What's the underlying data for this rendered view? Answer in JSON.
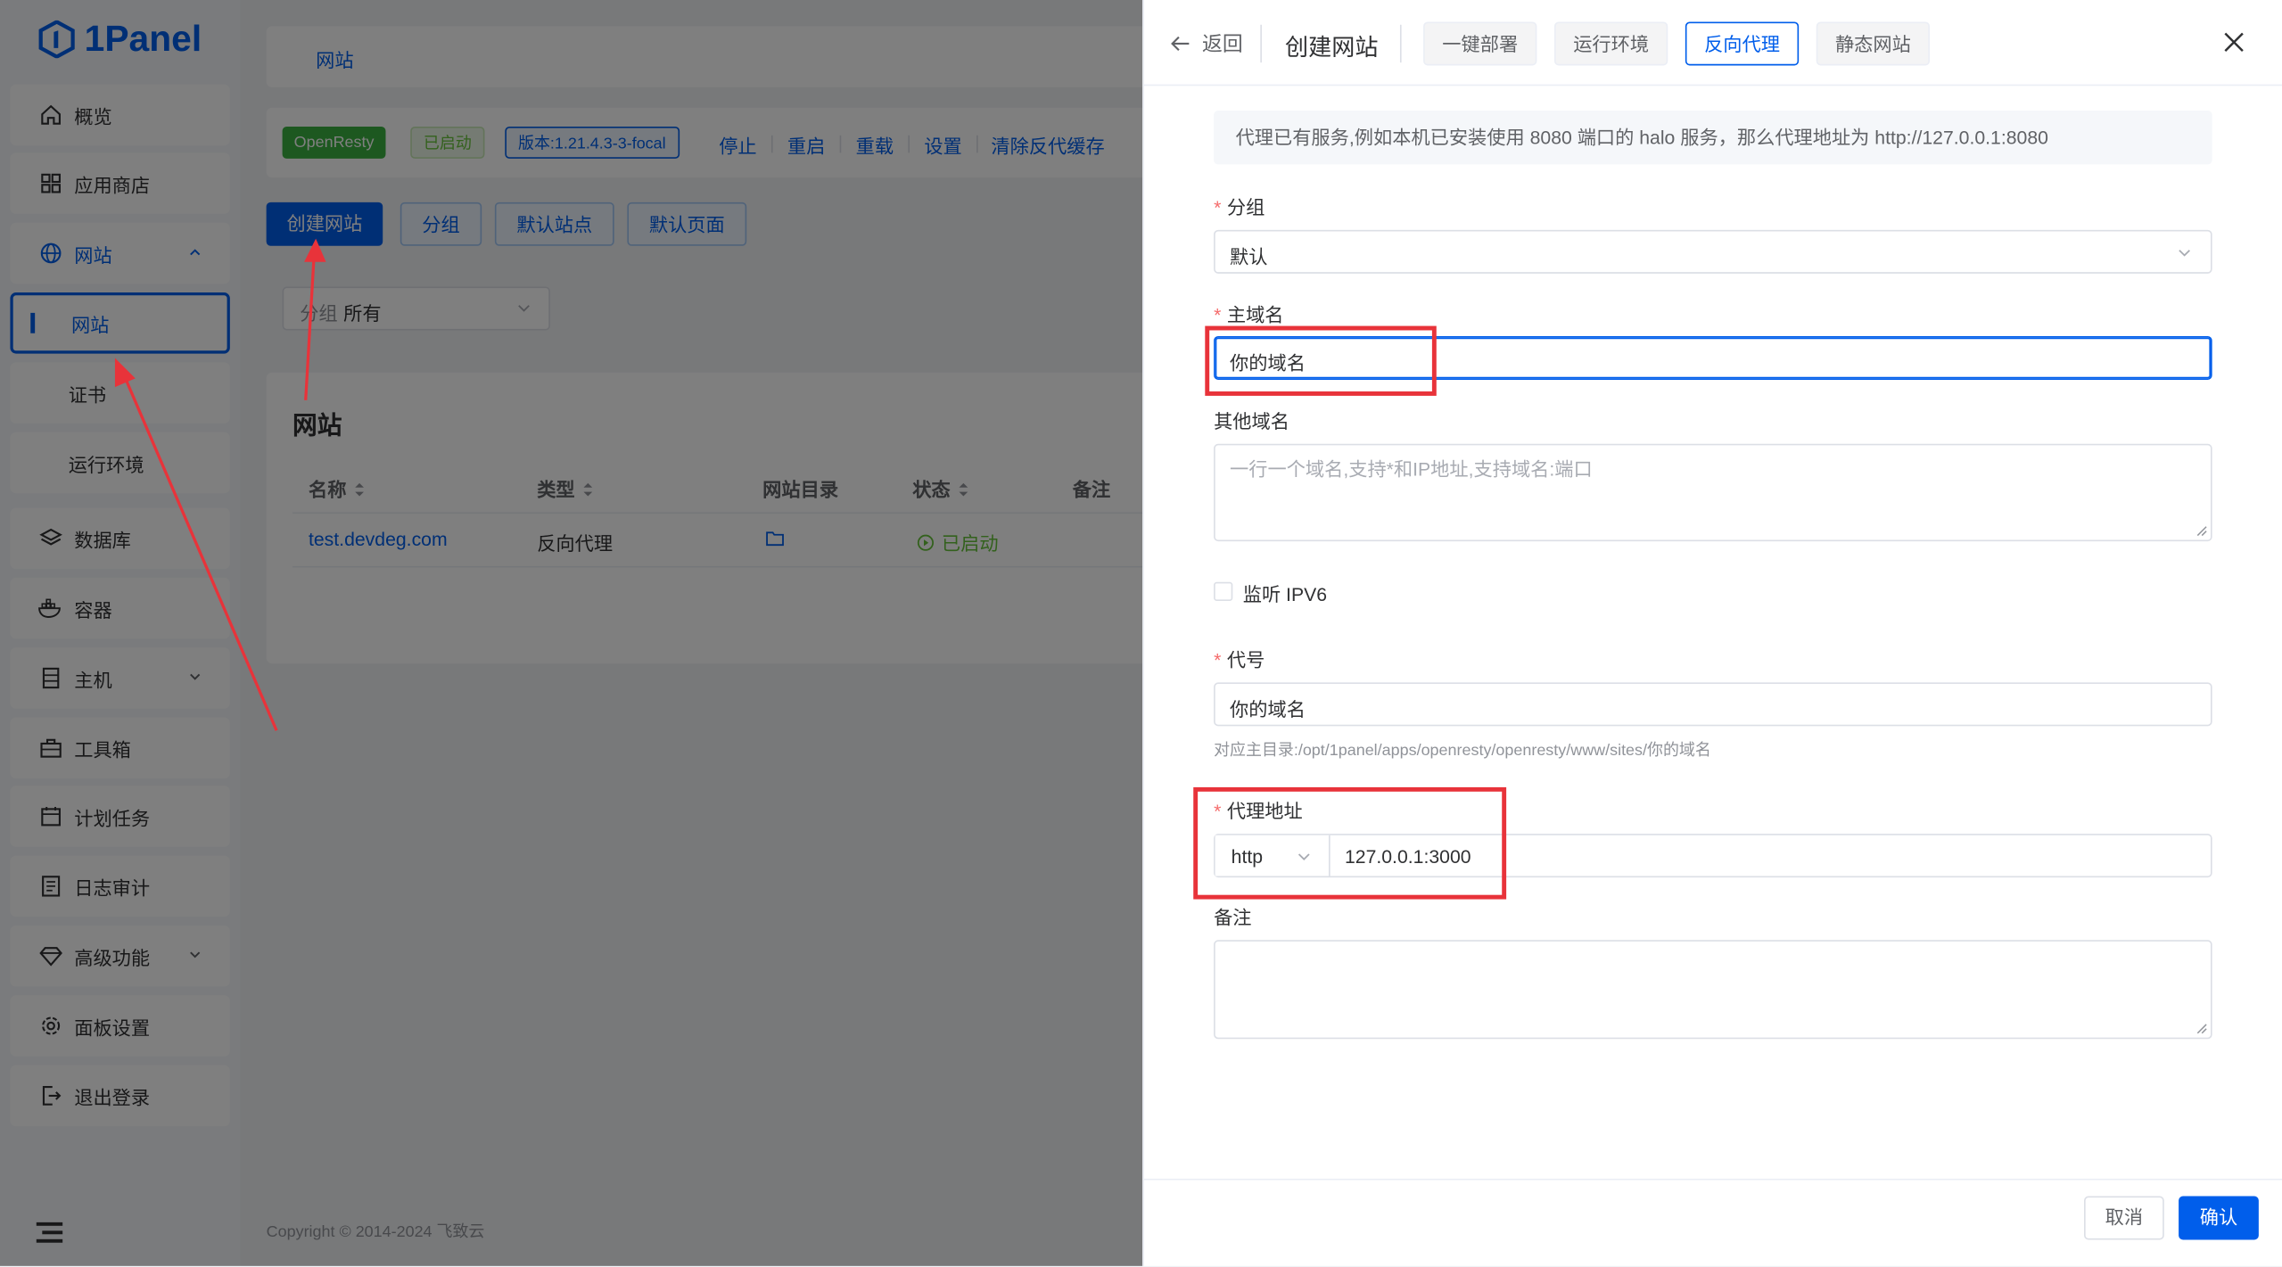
{
  "app": {
    "name": "1Panel",
    "brand_color": "#005eeb"
  },
  "sidebar": {
    "items": [
      {
        "label": "概览",
        "icon": "home-icon"
      },
      {
        "label": "应用商店",
        "icon": "grid-icon"
      },
      {
        "label": "网站",
        "icon": "globe-icon",
        "expanded": true
      },
      {
        "label": "网站",
        "icon": "",
        "active": true
      },
      {
        "label": "证书",
        "icon": ""
      },
      {
        "label": "运行环境",
        "icon": ""
      },
      {
        "label": "数据库",
        "icon": "layers-icon"
      },
      {
        "label": "容器",
        "icon": "docker-icon"
      },
      {
        "label": "主机",
        "icon": "server-icon"
      },
      {
        "label": "工具箱",
        "icon": "toolbox-icon"
      },
      {
        "label": "计划任务",
        "icon": "calendar-icon"
      },
      {
        "label": "日志审计",
        "icon": "log-icon"
      },
      {
        "label": "高级功能",
        "icon": "diamond-icon"
      },
      {
        "label": "面板设置",
        "icon": "gear-icon"
      },
      {
        "label": "退出登录",
        "icon": "logout-icon"
      }
    ]
  },
  "main": {
    "breadcrumb": "网站",
    "openresty": {
      "name": "OpenResty",
      "status": "已启动",
      "version": "版本:1.21.4.3-3-focal",
      "actions": [
        "停止",
        "重启",
        "重载",
        "设置",
        "清除反代缓存"
      ]
    },
    "buttons": [
      "创建网站",
      "分组",
      "默认站点",
      "默认页面"
    ],
    "filter": {
      "label": "分组",
      "value": "所有"
    },
    "table": {
      "title": "网站",
      "columns": [
        "名称",
        "类型",
        "网站目录",
        "状态",
        "备注"
      ],
      "rows": [
        {
          "name": "test.devdeg.com",
          "type": "反向代理",
          "status": "已启动"
        }
      ]
    },
    "footer": "Copyright © 2014-2024 飞致云"
  },
  "drawer": {
    "back": "返回",
    "title": "创建网站",
    "tabs": [
      "一键部署",
      "运行环境",
      "反向代理",
      "静态网站"
    ],
    "active_tab": "反向代理",
    "info": "代理已有服务,例如本机已安装使用 8080 端口的 halo 服务，那么代理地址为 http://127.0.0.1:8080",
    "group": {
      "label": "分组",
      "value": "默认"
    },
    "primary_domain": {
      "label": "主域名",
      "value": "你的域名"
    },
    "other_domains": {
      "label": "其他域名",
      "placeholder": "一行一个域名,支持*和IP地址,支持域名:端口"
    },
    "ipv6": {
      "label": "监听 IPV6"
    },
    "alias": {
      "label": "代号",
      "value": "你的域名",
      "hint": "对应主目录:/opt/1panel/apps/openresty/openresty/www/sites/你的域名"
    },
    "proxy": {
      "label": "代理地址",
      "scheme": "http",
      "address": "127.0.0.1:3000"
    },
    "remark": {
      "label": "备注"
    },
    "cancel": "取消",
    "confirm": "确认"
  },
  "annotation_color": "#e8333a"
}
